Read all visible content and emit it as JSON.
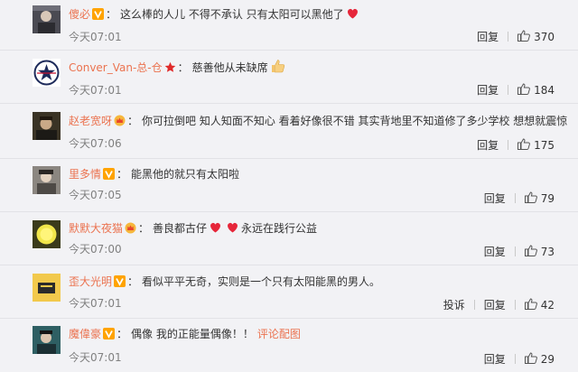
{
  "comments": [
    {
      "username": "傻必",
      "badge": "v-gold",
      "text": "这么棒的人儿 不得不承认 只有太阳可以黑他了",
      "emoji_after": "heart-emoji",
      "time": "今天07:01",
      "reply_label": "回复",
      "likes": "370"
    },
    {
      "username": "Conver_Van-总-仓",
      "badge": "star-red",
      "text": "慈善他从未缺席",
      "emoji_after": "thumbs-up-emoji",
      "time": "今天07:01",
      "reply_label": "回复",
      "likes": "184"
    },
    {
      "username": "赵老宽呀",
      "badge": "crown",
      "text": "你可拉倒吧 知人知面不知心 看着好像很不错 其实背地里不知道修了多少学校 想想就震惊",
      "time": "今天07:06",
      "reply_label": "回复",
      "likes": "175"
    },
    {
      "username": "里多情",
      "badge": "v-gold",
      "text": "能黑他的就只有太阳啦",
      "time": "今天07:05",
      "reply_label": "回复",
      "likes": "79"
    },
    {
      "username": "默默大夜猫",
      "badge": "crown",
      "text": "善良都古仔",
      "text2": "永远在践行公益",
      "time": "今天07:00",
      "reply_label": "回复",
      "likes": "73"
    },
    {
      "username": "歪大光明",
      "badge": "v-gold",
      "text": "看似平平无奇，实则是一个只有太阳能黑的男人。",
      "time": "今天07:01",
      "report_label": "投诉",
      "reply_label": "回复",
      "likes": "42"
    },
    {
      "username": "魔偉豪",
      "badge": "v-gold",
      "text": "偶像 我的正能量偶像！！",
      "link": "评论配图",
      "time": "今天07:01",
      "reply_label": "回复",
      "likes": "29"
    }
  ],
  "colors": {
    "username": "#eb7350",
    "background": "#f2f2f5",
    "time": "#808080"
  }
}
